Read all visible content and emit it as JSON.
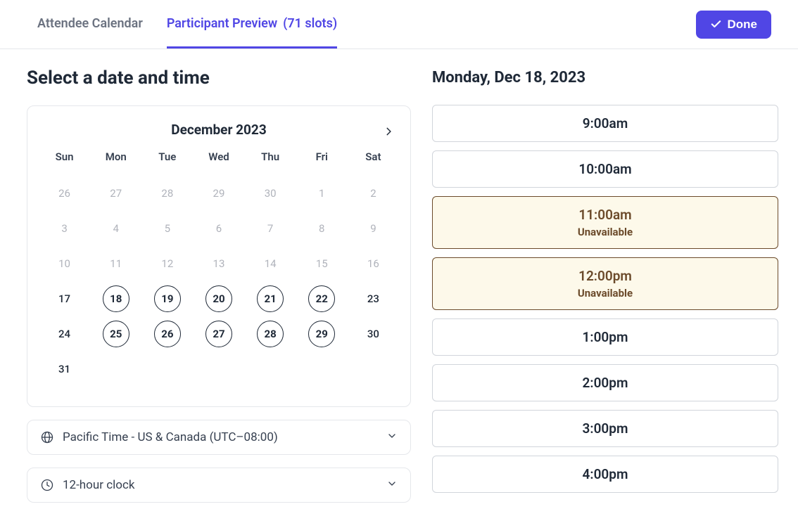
{
  "tabs": {
    "attendee": "Attendee Calendar",
    "participant_label": "Participant Preview",
    "participant_slots": "(71 slots)"
  },
  "done_label": "Done",
  "page_title": "Select a date and time",
  "selected_date_title": "Monday, Dec 18, 2023",
  "month_label": "December 2023",
  "dow": [
    "Sun",
    "Mon",
    "Tue",
    "Wed",
    "Thu",
    "Fri",
    "Sat"
  ],
  "weeks": [
    [
      {
        "n": "26",
        "state": "muted"
      },
      {
        "n": "27",
        "state": "muted"
      },
      {
        "n": "28",
        "state": "muted"
      },
      {
        "n": "29",
        "state": "muted"
      },
      {
        "n": "30",
        "state": "muted"
      },
      {
        "n": "1",
        "state": "muted"
      },
      {
        "n": "2",
        "state": "muted"
      }
    ],
    [
      {
        "n": "3",
        "state": "muted"
      },
      {
        "n": "4",
        "state": "muted"
      },
      {
        "n": "5",
        "state": "muted"
      },
      {
        "n": "6",
        "state": "muted"
      },
      {
        "n": "7",
        "state": "muted"
      },
      {
        "n": "8",
        "state": "muted"
      },
      {
        "n": "9",
        "state": "muted"
      }
    ],
    [
      {
        "n": "10",
        "state": "muted"
      },
      {
        "n": "11",
        "state": "muted"
      },
      {
        "n": "12",
        "state": "muted"
      },
      {
        "n": "13",
        "state": "muted"
      },
      {
        "n": "14",
        "state": "muted"
      },
      {
        "n": "15",
        "state": "muted"
      },
      {
        "n": "16",
        "state": "muted"
      }
    ],
    [
      {
        "n": "17",
        "state": "plain"
      },
      {
        "n": "18",
        "state": "circle"
      },
      {
        "n": "19",
        "state": "circle"
      },
      {
        "n": "20",
        "state": "circle"
      },
      {
        "n": "21",
        "state": "circle"
      },
      {
        "n": "22",
        "state": "circle"
      },
      {
        "n": "23",
        "state": "plain"
      }
    ],
    [
      {
        "n": "24",
        "state": "plain"
      },
      {
        "n": "25",
        "state": "circle"
      },
      {
        "n": "26",
        "state": "circle"
      },
      {
        "n": "27",
        "state": "circle"
      },
      {
        "n": "28",
        "state": "circle"
      },
      {
        "n": "29",
        "state": "circle"
      },
      {
        "n": "30",
        "state": "plain"
      }
    ],
    [
      {
        "n": "31",
        "state": "plain"
      },
      {
        "n": "",
        "state": "empty"
      },
      {
        "n": "",
        "state": "empty"
      },
      {
        "n": "",
        "state": "empty"
      },
      {
        "n": "",
        "state": "empty"
      },
      {
        "n": "",
        "state": "empty"
      },
      {
        "n": "",
        "state": "empty"
      }
    ]
  ],
  "timezone_label": "Pacific Time - US & Canada (UTC–08:00)",
  "clock_label": "12-hour clock",
  "unavailable_label": "Unavailable",
  "slots": [
    {
      "time": "9:00am",
      "available": true
    },
    {
      "time": "10:00am",
      "available": true
    },
    {
      "time": "11:00am",
      "available": false
    },
    {
      "time": "12:00pm",
      "available": false
    },
    {
      "time": "1:00pm",
      "available": true
    },
    {
      "time": "2:00pm",
      "available": true
    },
    {
      "time": "3:00pm",
      "available": true
    },
    {
      "time": "4:00pm",
      "available": true
    }
  ]
}
